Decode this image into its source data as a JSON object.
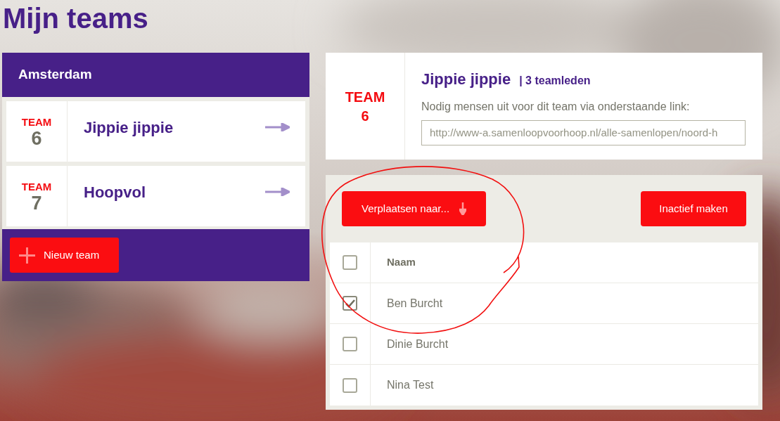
{
  "page_title": "Mijn teams",
  "group": {
    "title": "Amsterdam",
    "new_team_button": "Nieuw team",
    "teams": [
      {
        "team_label": "TEAM",
        "number": "6",
        "name": "Jippie jippie"
      },
      {
        "team_label": "TEAM",
        "number": "7",
        "name": "Hoopvol"
      }
    ]
  },
  "team_detail": {
    "team_label": "TEAM",
    "number": "6",
    "name": "Jippie jippie",
    "member_count": "| 3 teamleden",
    "invite_text": "Nodig mensen uit voor dit team via onderstaande link:",
    "invite_link": "http://www-a.samenloopvoorhoop.nl/alle-samenlopen/noord-h"
  },
  "actions": {
    "move_button": "Verplaatsen naar...",
    "deactivate_button": "Inactief maken"
  },
  "members_table": {
    "select_all": {
      "checked": false
    },
    "column": "Naam",
    "rows": [
      {
        "name": "Ben Burcht",
        "checked": true
      },
      {
        "name": "Dinie Burcht",
        "checked": false
      },
      {
        "name": "Nina Test",
        "checked": false
      }
    ]
  }
}
